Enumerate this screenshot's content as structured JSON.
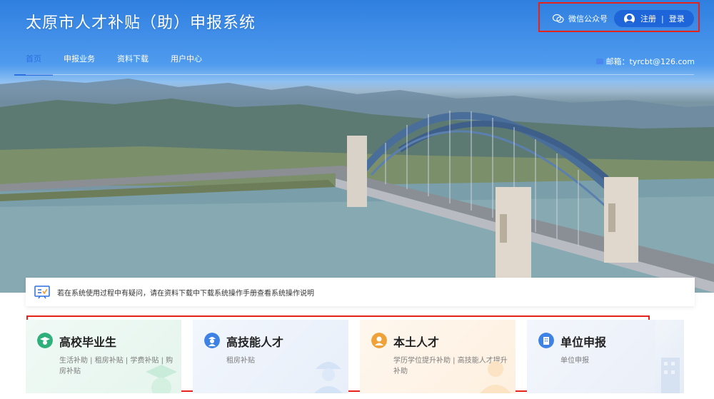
{
  "header": {
    "title": "太原市人才补贴（助）申报系统",
    "wechat_label": "微信公众号",
    "register_label": "注册",
    "separator": "|",
    "login_label": "登录",
    "email_text": "邮箱：tyrcbt@126.com"
  },
  "nav": {
    "items": [
      {
        "label": "首页",
        "active": true
      },
      {
        "label": "申报业务",
        "active": false
      },
      {
        "label": "资料下载",
        "active": false
      },
      {
        "label": "用户中心",
        "active": false
      }
    ]
  },
  "notice": {
    "text": "若在系统使用过程中有疑问，请在资料下载中下载系统操作手册查看系统操作说明"
  },
  "cards": [
    {
      "title": "高校毕业生",
      "subtitle": "生活补助 | 租房补贴 | 学费补贴 | 购房补贴",
      "icon": "graduate-icon",
      "color": "#2fb07a"
    },
    {
      "title": "高技能人才",
      "subtitle": "租房补贴",
      "icon": "worker-icon",
      "color": "#3f82e6"
    },
    {
      "title": "本土人才",
      "subtitle": "学历学位提升补助 | 高技能人才提升补助",
      "icon": "local-talent-icon",
      "color": "#f0a23a"
    },
    {
      "title": "单位申报",
      "subtitle": "单位申报",
      "icon": "building-icon",
      "color": "#3f82e6"
    }
  ],
  "colors": {
    "primary": "#2b6fe0",
    "highlight_border": "#e5231b"
  }
}
